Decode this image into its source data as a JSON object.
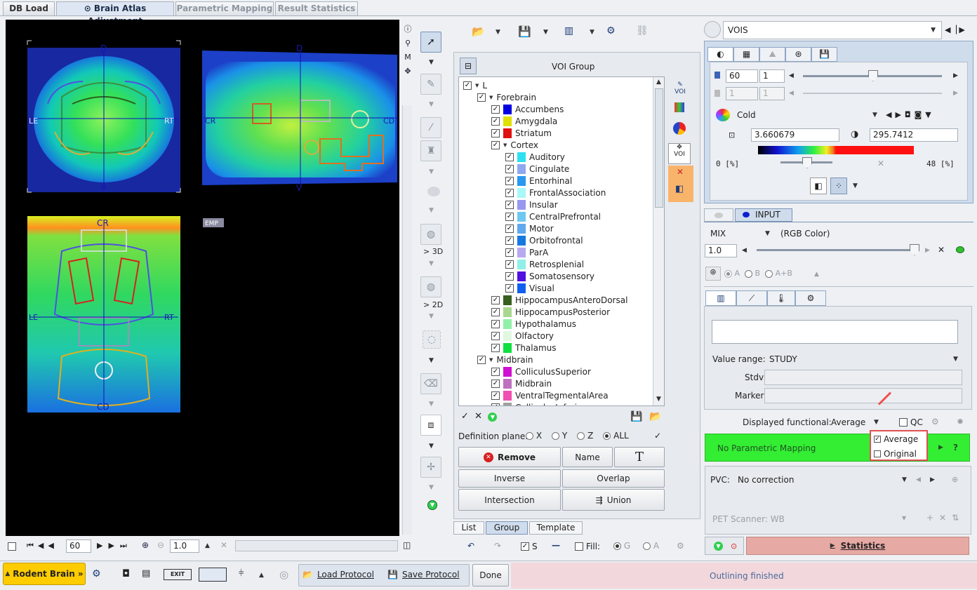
{
  "tabs": {
    "db_load": "DB Load",
    "brain_atlas": "Brain Atlas Adjustment",
    "parametric": "Parametric Mapping",
    "result_stats": "Result Statistics"
  },
  "viewer": {
    "coronal": {
      "top": "D",
      "bottom": "V",
      "left": "LE",
      "right": "RT"
    },
    "sagittal": {
      "top": "D",
      "bottom": "V",
      "left": "CR",
      "right": "CD"
    },
    "axial": {
      "top": "CR",
      "bottom": "CD",
      "left": "LE",
      "right": "RT"
    },
    "emp_label": "EMP",
    "side_letters": {
      "m": "M"
    },
    "slice_value": "60",
    "zoom_value": "1.0"
  },
  "tools": {
    "to3d": "> 3D",
    "to2d": "> 2D"
  },
  "voi": {
    "header": "VOI Group",
    "tree": [
      {
        "label": "L",
        "level": 0,
        "exp": true,
        "color": null
      },
      {
        "label": "Forebrain",
        "level": 1,
        "exp": true,
        "color": null
      },
      {
        "label": "Accumbens",
        "level": 2,
        "color": "#0000e0"
      },
      {
        "label": "Amygdala",
        "level": 2,
        "color": "#e0e000"
      },
      {
        "label": "Striatum",
        "level": 2,
        "color": "#e01010"
      },
      {
        "label": "Cortex",
        "level": 2,
        "exp": true,
        "color": null
      },
      {
        "label": "Auditory",
        "level": 3,
        "color": "#30e0f0"
      },
      {
        "label": "Cingulate",
        "level": 3,
        "color": "#90a8f0"
      },
      {
        "label": "Entorhinal",
        "level": 3,
        "color": "#2898f0"
      },
      {
        "label": "FrontalAssociation",
        "level": 3,
        "color": "#a8f8f8"
      },
      {
        "label": "Insular",
        "level": 3,
        "color": "#9898f0"
      },
      {
        "label": "CentralPrefrontal",
        "level": 3,
        "color": "#70c8f0"
      },
      {
        "label": "Motor",
        "level": 3,
        "color": "#60a8f0"
      },
      {
        "label": "Orbitofrontal",
        "level": 3,
        "color": "#1878e0"
      },
      {
        "label": "ParA",
        "level": 3,
        "color": "#b8a8f0"
      },
      {
        "label": "Retrosplenial",
        "level": 3,
        "color": "#90f0e8"
      },
      {
        "label": "Somatosensory",
        "level": 3,
        "color": "#5010e0"
      },
      {
        "label": "Visual",
        "level": 3,
        "color": "#1060f0"
      },
      {
        "label": "HippocampusAnteroDorsal",
        "level": 2,
        "color": "#386020"
      },
      {
        "label": "HippocampusPosterior",
        "level": 2,
        "color": "#a8d890"
      },
      {
        "label": "Hypothalamus",
        "level": 2,
        "color": "#90f0a8"
      },
      {
        "label": "Olfactory",
        "level": 2,
        "color": "#e0f8e0"
      },
      {
        "label": "Thalamus",
        "level": 2,
        "color": "#10e040"
      },
      {
        "label": "Midbrain",
        "level": 1,
        "exp": true,
        "color": null
      },
      {
        "label": "ColliculusSuperior",
        "level": 2,
        "color": "#d010d0"
      },
      {
        "label": "Midbrain",
        "level": 2,
        "color": "#c070c0"
      },
      {
        "label": "VentralTegmentalArea",
        "level": 2,
        "color": "#f050b0"
      },
      {
        "label": "ColliculusInferior",
        "level": 2,
        "color": "#a0a0a0"
      }
    ],
    "def_plane_label": "Definition plane:",
    "planes": [
      "X",
      "Y",
      "Z",
      "ALL"
    ],
    "btn_remove": "Remove",
    "btn_name": "Name",
    "btn_t": "T",
    "btn_inverse": "Inverse",
    "btn_overlap": "Overlap",
    "btn_intersection": "Intersection",
    "btn_union": "Union",
    "bottom_tabs": [
      "List",
      "Group",
      "Template"
    ],
    "fill_label": "Fill:",
    "s_label": "S",
    "g_label": "G",
    "a_label": "A"
  },
  "side_voi_label": "VOI",
  "right": {
    "vois_select": "VOIS",
    "frame_val": "60",
    "frame_val2": "1",
    "colormap": "Cold",
    "min_val": "3.660679",
    "max_val": "295.7412",
    "scale_min": "0 [%]",
    "scale_max": "48 [%]",
    "input_tab": "INPUT",
    "mix_label": "MIX",
    "mix_mode": "(RGB Color)",
    "mix_val": "1.0",
    "radio_a": "A",
    "radio_b": "B",
    "radio_ab": "A+B",
    "value_range_label": "Value range:",
    "value_range": "STUDY",
    "stdv_label": "Stdv",
    "marker_label": "Marker",
    "disp_func_label": "Displayed functional:",
    "disp_func_value": "Average",
    "qc_label": "QC",
    "dropdown": [
      "Average",
      "Original"
    ],
    "no_param": "No Parametric Mapping",
    "q_mark": "?",
    "pvc_label": "PVC:",
    "pvc_value": "No correction",
    "pet_scanner": "PET Scanner:  WB",
    "statistics": "Statistics"
  },
  "bottom": {
    "rodent_brain": "Rodent Brain »",
    "load_protocol": "Load Protocol",
    "save_protocol": "Save Protocol",
    "done": "Done",
    "status": "Outlining finished"
  },
  "colors": {
    "accent": "#ffcc00",
    "green": "#33ee33",
    "stats_bg": "#e6a9a4",
    "tool_orange": "#f9b46b"
  }
}
